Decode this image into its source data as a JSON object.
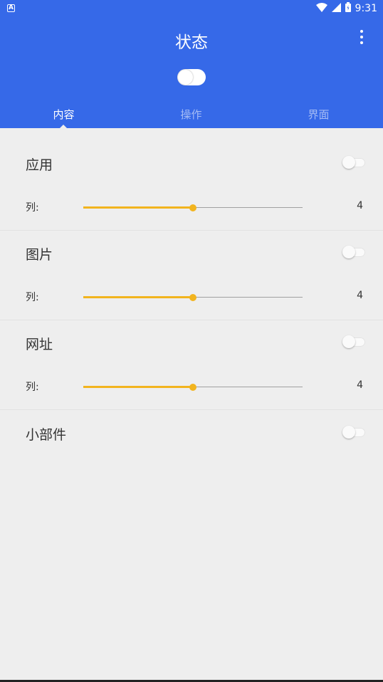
{
  "statusbar": {
    "notif_icon": "A",
    "time": "9:31",
    "icons": [
      "wifi-icon",
      "cell-signal-icon",
      "battery-icon"
    ]
  },
  "header": {
    "title": "状态",
    "menu_icon": "more-vert-icon",
    "master_switch": "on"
  },
  "tabs": [
    {
      "label": "内容",
      "active": true
    },
    {
      "label": "操作",
      "active": false
    },
    {
      "label": "界面",
      "active": false
    }
  ],
  "sections": [
    {
      "title": "应用",
      "enabled": false,
      "column_label": "列:",
      "columns": 4,
      "slider_fraction": 0.5
    },
    {
      "title": "图片",
      "enabled": false,
      "column_label": "列:",
      "columns": 4,
      "slider_fraction": 0.5
    },
    {
      "title": "网址",
      "enabled": false,
      "column_label": "列:",
      "columns": 4,
      "slider_fraction": 0.5
    },
    {
      "title": "小部件",
      "enabled": false
    }
  ],
  "colors": {
    "primary": "#3669e8",
    "accent": "#f2b41e",
    "background": "#eeeeee"
  }
}
